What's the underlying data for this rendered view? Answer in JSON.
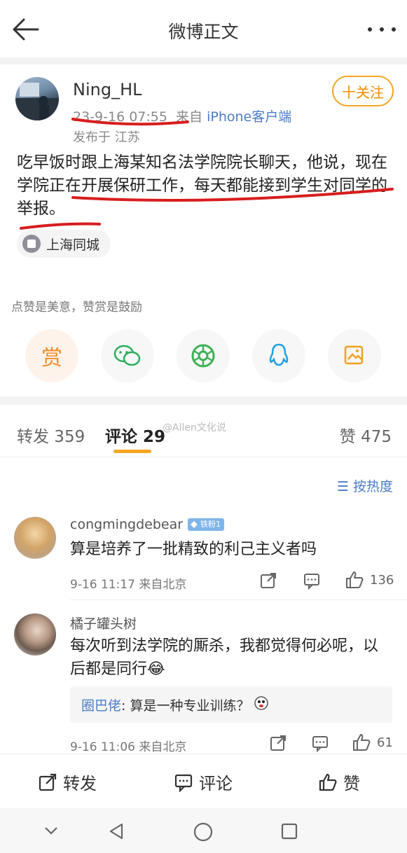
{
  "header": {
    "title": "微博正文"
  },
  "post": {
    "username": "Ning_HL",
    "follow_label": "十关注",
    "time": "23-9-16 07:55",
    "source_prefix": "来自",
    "source": "iPhone客户端",
    "location": "发布于 江苏",
    "text": "吃早饭时跟上海某知名法学院院长聊天，他说，现在学院正在开展保研工作，每天都能接到学生对同学的举报。",
    "topic_tag": "上海同城",
    "reward_text": "点赞是美意，赞赏是鼓励",
    "reward_label": "赏"
  },
  "tabs": {
    "repost": "转发 359",
    "comment": "评论 29",
    "like": "赞 475"
  },
  "watermark": "@Allen文化说",
  "sort_label": "按热度",
  "comments": [
    {
      "name": "congmingdebear",
      "badge": "铁粉1",
      "text": "算是培养了一批精致的利己主义者吗",
      "time": "9-16 11:17 来自北京",
      "likes": "136"
    },
    {
      "name": "橘子罐头树",
      "text": "每次听到法学院的厮杀，我都觉得何必呢，以后都是同行😂",
      "reply_name": "圈巴佬",
      "reply_text": ": 算是一种专业训练？",
      "time": "9-16 11:06 来自北京",
      "likes": "61"
    }
  ],
  "bottom": {
    "repost": "转发",
    "comment": "评论",
    "like": "赞"
  },
  "colors": {
    "accent": "#f5a623",
    "link": "#4a7cc7",
    "annotation": "#d81e1e"
  }
}
